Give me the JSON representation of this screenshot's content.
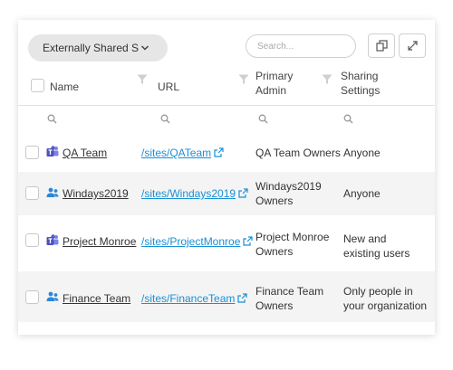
{
  "toolbar": {
    "dropdown_label": "Externally Shared S",
    "search_placeholder": "Search..."
  },
  "columns": {
    "name": "Name",
    "url": "URL",
    "admin_line1": "Primary",
    "admin_line2": "Admin",
    "sharing_line1": "Sharing",
    "sharing_line2": "Settings"
  },
  "rows": [
    {
      "type": "teams",
      "name": "QA Team",
      "url": "/sites/QATeam",
      "admin": [
        "QA Team Owners"
      ],
      "sharing": [
        "Anyone"
      ]
    },
    {
      "type": "group",
      "name": "Windays2019",
      "url": "/sites/Windays2019",
      "admin": [
        "Windays2019",
        "Owners"
      ],
      "sharing": [
        "Anyone"
      ]
    },
    {
      "type": "teams",
      "name": "Project Monroe",
      "url": "/sites/ProjectMonroe",
      "admin": [
        "Project Monroe",
        "Owners"
      ],
      "sharing": [
        "New and",
        "existing users"
      ]
    },
    {
      "type": "group",
      "name": "Finance Team",
      "url": "/sites/FinanceTeam",
      "admin": [
        "Finance Team",
        "Owners"
      ],
      "sharing": [
        "Only people in",
        "your organization"
      ]
    }
  ],
  "colors": {
    "link": "#1a8fd6",
    "teams_icon": "#5b5fc7",
    "group_icon": "#2b88d8"
  }
}
